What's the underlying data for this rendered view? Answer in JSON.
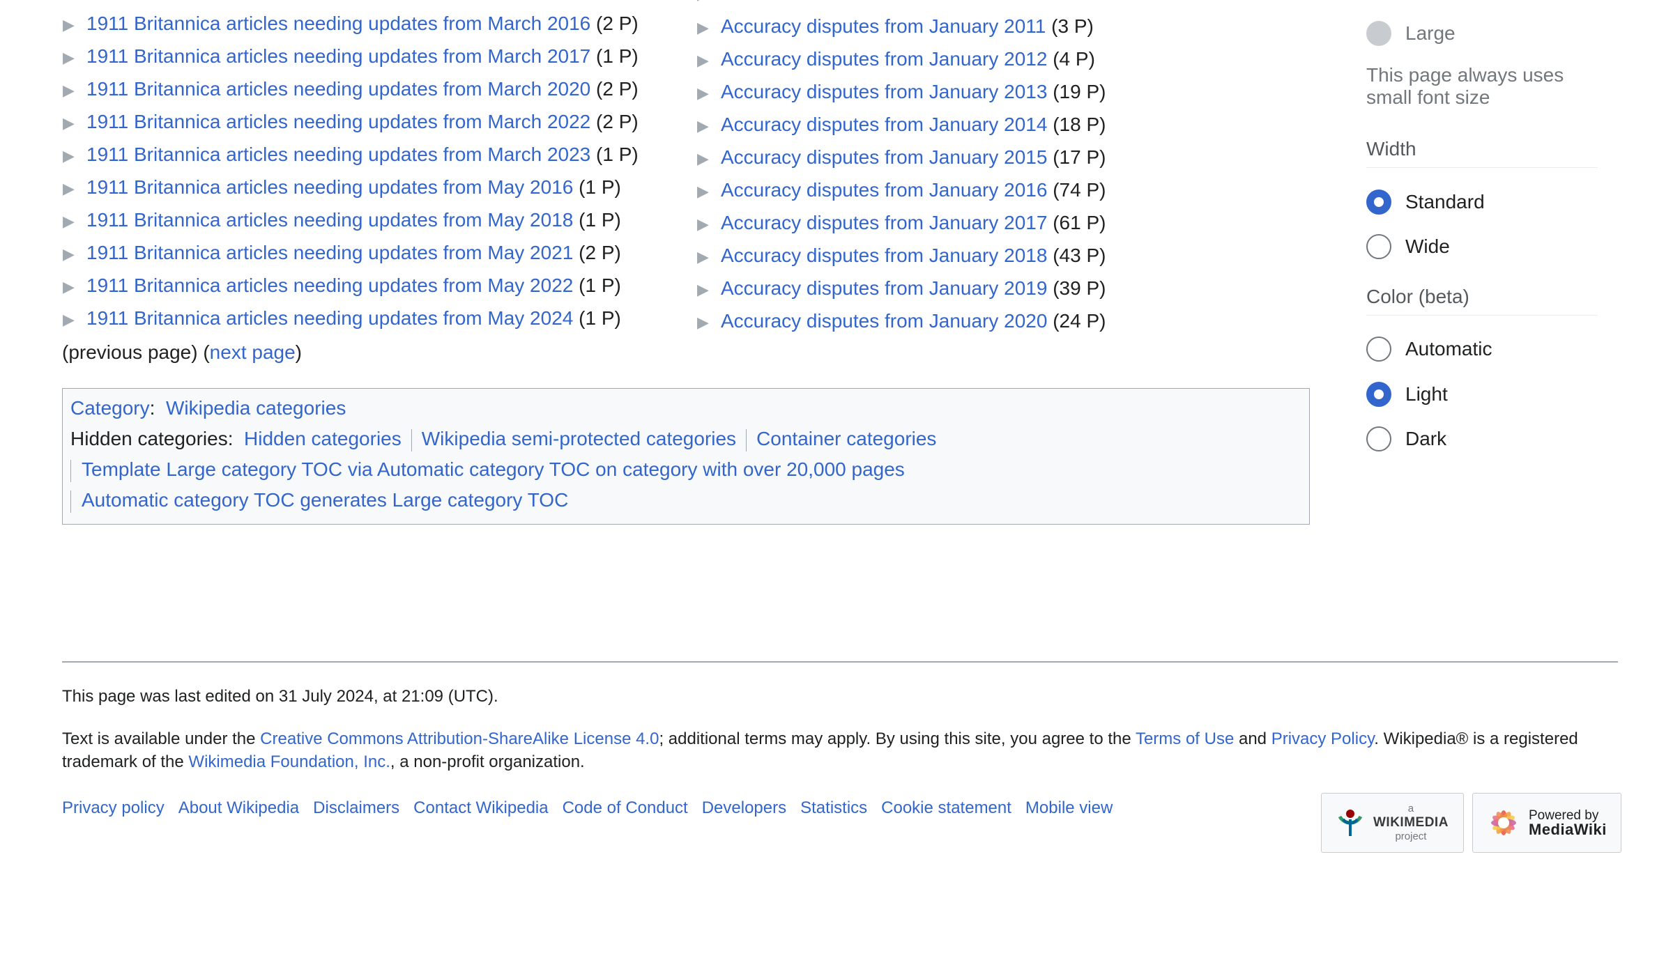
{
  "categories_left": [
    {
      "label": "1911 Britannica articles needing updates from March 2016",
      "count": "(2 P)"
    },
    {
      "label": "1911 Britannica articles needing updates from March 2017",
      "count": "(1 P)"
    },
    {
      "label": "1911 Britannica articles needing updates from March 2020",
      "count": "(2 P)"
    },
    {
      "label": "1911 Britannica articles needing updates from March 2022",
      "count": "(2 P)"
    },
    {
      "label": "1911 Britannica articles needing updates from March 2023",
      "count": "(1 P)"
    },
    {
      "label": "1911 Britannica articles needing updates from May 2016",
      "count": "(1 P)"
    },
    {
      "label": "1911 Britannica articles needing updates from May 2018",
      "count": "(1 P)"
    },
    {
      "label": "1911 Britannica articles needing updates from May 2021",
      "count": "(2 P)"
    },
    {
      "label": "1911 Britannica articles needing updates from May 2022",
      "count": "(1 P)"
    },
    {
      "label": "1911 Britannica articles needing updates from May 2024",
      "count": "(1 P)"
    }
  ],
  "categories_right": [
    {
      "label": "Accuracy disputes from January 2011",
      "count": "(3 P)"
    },
    {
      "label": "Accuracy disputes from January 2012",
      "count": "(4 P)"
    },
    {
      "label": "Accuracy disputes from January 2013",
      "count": "(19 P)"
    },
    {
      "label": "Accuracy disputes from January 2014",
      "count": "(18 P)"
    },
    {
      "label": "Accuracy disputes from January 2015",
      "count": "(17 P)"
    },
    {
      "label": "Accuracy disputes from January 2016",
      "count": "(74 P)"
    },
    {
      "label": "Accuracy disputes from January 2017",
      "count": "(61 P)"
    },
    {
      "label": "Accuracy disputes from January 2018",
      "count": "(43 P)"
    },
    {
      "label": "Accuracy disputes from January 2019",
      "count": "(39 P)"
    },
    {
      "label": "Accuracy disputes from January 2020",
      "count": "(24 P)"
    }
  ],
  "pager": {
    "previous": "(previous page)",
    "next": "next page"
  },
  "catlinks": {
    "category_label": "Category",
    "category_value": "Wikipedia categories",
    "hidden_label": "Hidden categories:",
    "hidden": [
      "Hidden categories",
      "Wikipedia semi-protected categories",
      "Container categories",
      "Template Large category TOC via Automatic category TOC on category with over 20,000 pages",
      "Automatic category TOC generates Large category TOC"
    ]
  },
  "appearance": {
    "text_options": [
      {
        "label": "Large",
        "disabled": true
      }
    ],
    "note": "This page always uses small font size",
    "width_heading": "Width",
    "width_options": [
      {
        "label": "Standard",
        "checked": true
      },
      {
        "label": "Wide",
        "checked": false
      }
    ],
    "color_heading": "Color (beta)",
    "color_options": [
      {
        "label": "Automatic",
        "checked": false
      },
      {
        "label": "Light",
        "checked": true
      },
      {
        "label": "Dark",
        "checked": false
      }
    ],
    "accent_color": "#3366cc"
  },
  "footer": {
    "last_edited": "This page was last edited on 31 July 2024, at 21:09 (UTC).",
    "license_pre": "Text is available under the ",
    "license_link": "Creative Commons Attribution-ShareAlike License 4.0",
    "license_mid": "; additional terms may apply. By using this site, you agree to the ",
    "terms_link": "Terms of Use",
    "and_text": " and ",
    "privacy_link": "Privacy Policy",
    "license_post": ". Wikipedia® is a registered trademark of the ",
    "foundation_link": "Wikimedia Foundation, Inc.",
    "license_end": ", a non-profit organization.",
    "links": [
      "Privacy policy",
      "About Wikipedia",
      "Disclaimers",
      "Contact Wikipedia",
      "Code of Conduct",
      "Developers",
      "Statistics",
      "Cookie statement",
      "Mobile view"
    ],
    "wikimedia_badge": {
      "top": "a",
      "name": "WIKIMEDIA",
      "bottom": "project"
    },
    "mediawiki_badge": {
      "top": "Powered by",
      "name": "MediaWiki"
    }
  },
  "colors": {
    "link": "#3366cc",
    "text": "#202122",
    "border": "#a2a9b1"
  }
}
